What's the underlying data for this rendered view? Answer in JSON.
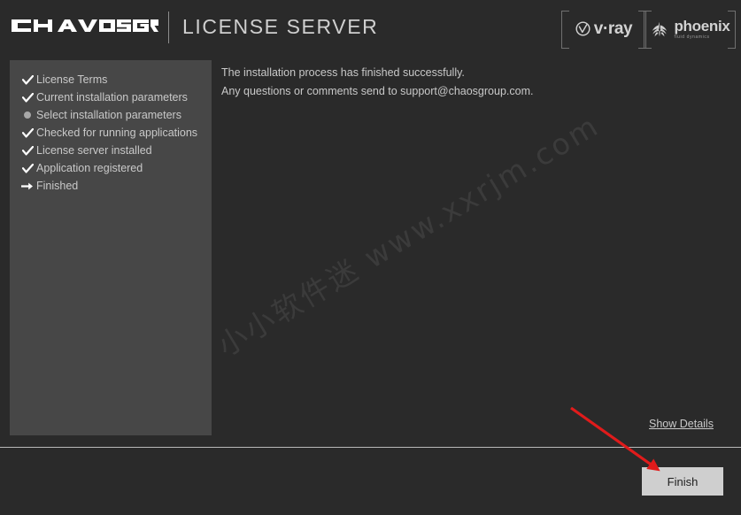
{
  "header": {
    "logo_name": "CHAOSGROUP",
    "title": "LICENSE SERVER",
    "brands": [
      {
        "name": "v·ray",
        "icon": "vray-circle-check-icon",
        "subtitle": ""
      },
      {
        "name": "phoenix",
        "icon": "phoenix-bird-icon",
        "subtitle": "fluid dynamics"
      }
    ]
  },
  "sidebar": {
    "steps": [
      {
        "label": "License Terms",
        "marker": "check-icon"
      },
      {
        "label": "Current installation parameters",
        "marker": "check-icon"
      },
      {
        "label": "Select installation parameters",
        "marker": "dot-icon"
      },
      {
        "label": "Checked for running applications",
        "marker": "check-icon"
      },
      {
        "label": "License server installed",
        "marker": "check-icon"
      },
      {
        "label": "Application registered",
        "marker": "check-icon"
      },
      {
        "label": "Finished",
        "marker": "arrow-right-icon"
      }
    ]
  },
  "main": {
    "lines": [
      "The installation process has finished successfully.",
      "Any questions or comments send to support@chaosgroup.com."
    ]
  },
  "watermark": {
    "text": "小小软件迷 www.xxrjm.com"
  },
  "footer": {
    "show_details_label": "Show Details",
    "finish_label": "Finish"
  },
  "annotation": {
    "arrow_color": "#e01b1b"
  },
  "colors": {
    "background": "#2a2a2a",
    "sidebar_panel": "#474747",
    "text": "#c9c9c9",
    "button_face": "#cfcfcf",
    "separator": "#b9b9b9"
  }
}
